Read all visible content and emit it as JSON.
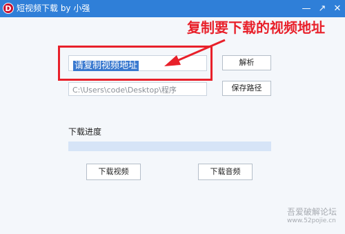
{
  "window": {
    "title": "短视频下载 by 小强",
    "icon_letter": "D",
    "controls": [
      "minimize-icon",
      "maximize-icon",
      "close-icon"
    ]
  },
  "url_input": {
    "value": "请复制视频地址"
  },
  "parse_button": {
    "label": "解析"
  },
  "path_input": {
    "value": "C:\\Users\\code\\Desktop\\程序"
  },
  "save_path_button": {
    "label": "保存路径"
  },
  "progress": {
    "label": "下载进度",
    "value_percent": 0
  },
  "download_video_button": {
    "label": "下载视频"
  },
  "download_audio_button": {
    "label": "下载音频"
  },
  "annotation": {
    "text": "复制要下载的视频地址",
    "color": "#e8202a"
  },
  "watermark": {
    "text": "吾爱破解论坛",
    "url": "www.52pojie.cn"
  },
  "colors": {
    "titlebar": "#2f7fd8",
    "selection": "#3a79cf",
    "progress_track": "#d6e4f7"
  }
}
